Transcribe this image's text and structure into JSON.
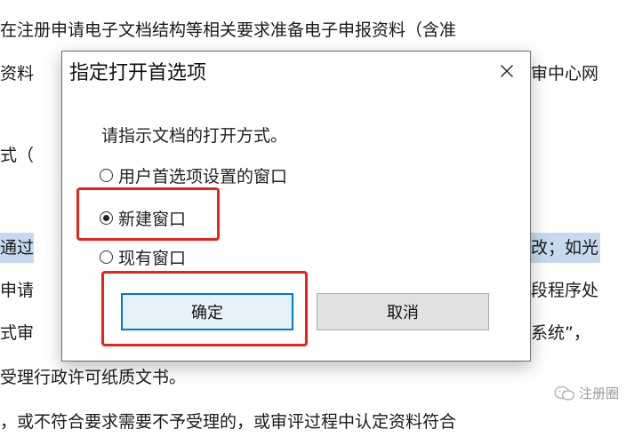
{
  "document": {
    "lines": [
      "在注册申请电子文档结构等相关要求准备电子申报资料（含准",
      "资料",
      "式（",
      "通过",
      "申请",
      "式审",
      "受理行政许可纸质文书。",
      "，或不符合要求需要不予受理的，或审评过程中认定资料符合"
    ],
    "right_fragments": [
      "审中心网",
      "改；如光",
      "段程序处",
      "系统”，"
    ]
  },
  "dialog": {
    "title": "指定打开首选项",
    "close_glyph": "✕",
    "prompt": "请指示文档的打开方式。",
    "options": [
      {
        "label": "用户首选项设置的窗口",
        "selected": false
      },
      {
        "label": "新建窗口",
        "selected": true
      },
      {
        "label": "现有窗口",
        "selected": false
      }
    ],
    "ok_label": "确定",
    "cancel_label": "取消"
  },
  "colors": {
    "annotation": "#e8231b",
    "focus_border": "#0078d7",
    "highlight": "#c5d9ef"
  },
  "watermark": {
    "text": "注册圈",
    "icon": "wechat-icon"
  }
}
